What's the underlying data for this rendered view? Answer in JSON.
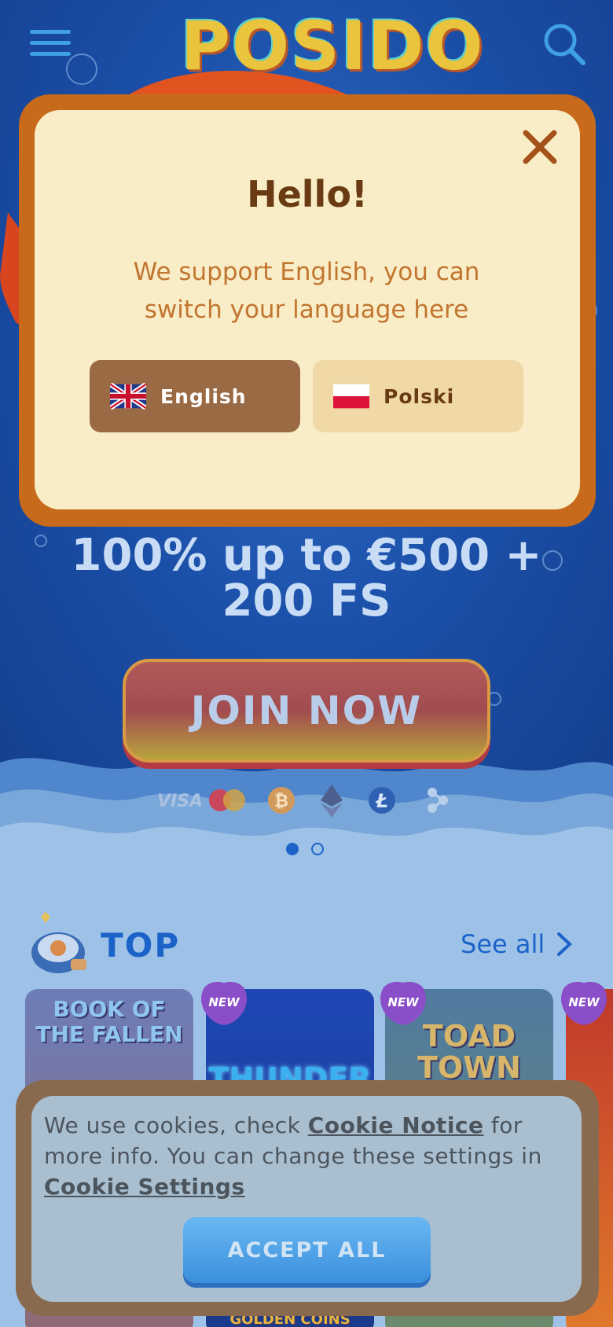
{
  "header": {
    "logo_text": "POSIDO",
    "menu_icon": "hamburger-menu-icon",
    "search_icon": "search-icon"
  },
  "language_modal": {
    "title": "Hello!",
    "message": "We support English, you can switch your language here",
    "close_icon": "close-icon",
    "languages": [
      {
        "label": "English",
        "flag": "uk-flag-icon",
        "selected": true
      },
      {
        "label": "Polski",
        "flag": "poland-flag-icon",
        "selected": false
      }
    ]
  },
  "promo": {
    "bonus_text": "100% up to €500 + 200 FS",
    "join_label": "JOIN NOW"
  },
  "payments": {
    "items": [
      "VISA",
      "mastercard-icon",
      "bitcoin-icon",
      "ethereum-icon",
      "litecoin-icon",
      "ripple-icon"
    ]
  },
  "carousel": {
    "slide_count": 2,
    "active_index": 0
  },
  "top_section": {
    "title": "TOP",
    "see_all_label": "See all",
    "games": [
      {
        "title": "BOOK OF THE FALLEN",
        "is_new": false
      },
      {
        "title": "THUNDER",
        "is_new": true,
        "bottom_text": "GOLDEN COINS"
      },
      {
        "title": "TOAD TOWN",
        "is_new": true
      },
      {
        "title": "",
        "is_new": true
      }
    ],
    "new_badge_label": "NEW"
  },
  "cookie_banner": {
    "text_before": "We use cookies, check ",
    "link1": "Cookie Notice",
    "text_middle": " for more info. You can change these settings in ",
    "link2": "Cookie Settings",
    "accept_label": "ACCEPT ALL"
  },
  "colors": {
    "brand_blue": "#1b63c9",
    "modal_bg": "#f8edc7",
    "modal_frame": "#c76a1b",
    "title_brown": "#6a3b13",
    "message_orange": "#c2752f"
  }
}
